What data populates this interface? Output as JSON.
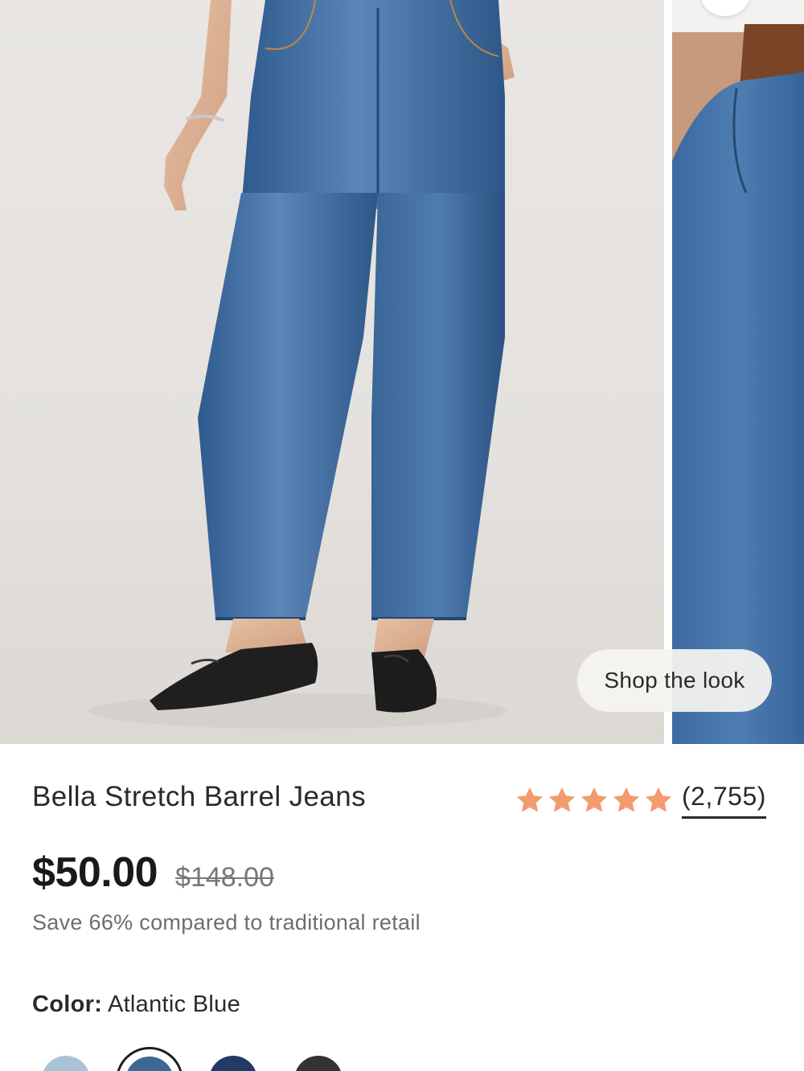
{
  "gallery": {
    "shop_the_look_label": "Shop the look"
  },
  "product": {
    "title": "Bella Stretch Barrel Jeans",
    "rating": 5,
    "review_count": "(2,755)",
    "price": "$50.00",
    "original_price": "$148.00",
    "savings_text": "Save 66% compared to traditional retail",
    "color_label": "Color:",
    "color_value": "Atlantic Blue",
    "swatches": [
      {
        "name": "light-blue",
        "color": "#a9c3d6",
        "selected": false
      },
      {
        "name": "atlantic-blue",
        "color": "#3f6796",
        "selected": true
      },
      {
        "name": "navy",
        "color": "#223a66",
        "selected": false
      },
      {
        "name": "black",
        "color": "#333333",
        "selected": false
      }
    ]
  },
  "colors": {
    "star": "#f39b6d",
    "denim": "#3d6a9e"
  }
}
